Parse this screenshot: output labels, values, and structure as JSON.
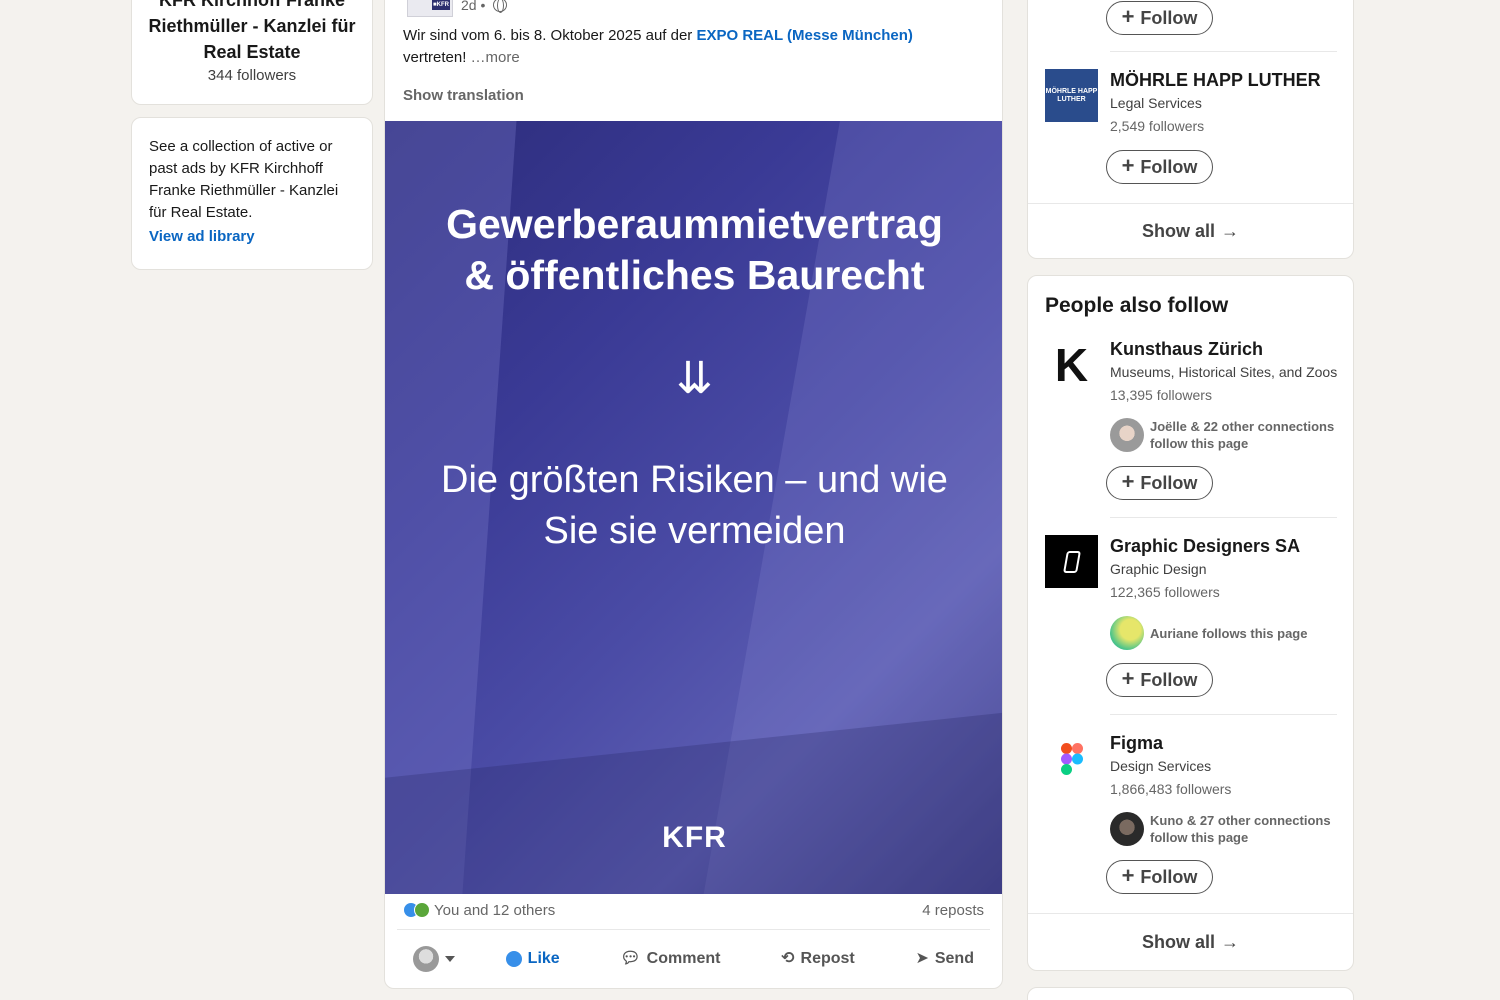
{
  "left": {
    "org_name": "KFR Kirchhoff Franke Riethmüller - Kanzlei für Real Estate",
    "followers": "344 followers",
    "ads_text": "See a collection of active or past ads by KFR Kirchhoff Franke Riethmüller - Kanzlei für Real Estate.",
    "ads_link": "View ad library"
  },
  "post": {
    "time": "2d •",
    "text_before": "Wir sind vom 6. bis 8. Oktober 2025 auf der ",
    "hashtag": "EXPO REAL (Messe München)",
    "text_after": " vertreten!",
    "more": "…more",
    "show_translation": "Show translation",
    "image": {
      "title_line1": "Gewerberaummietvertrag",
      "title_line2": "& öffentliches Baurecht",
      "arrow": "⇊",
      "sub_line1": "Die größten Risiken – und wie",
      "sub_line2": "Sie sie vermeiden",
      "brand": "KFR"
    },
    "reactions": "You and 12 others",
    "reposts": "4 reposts",
    "actions": {
      "like": "Like",
      "comment": "Comment",
      "repost": "Repost",
      "send": "Send"
    }
  },
  "right_top": {
    "follow_label": "Follow",
    "company": {
      "name": "MÖHRLE HAPP LUTHER",
      "logo_text": "MÖHRLE HAPP LUTHER",
      "industry": "Legal Services",
      "followers": "2,549 followers"
    },
    "show_all": "Show all"
  },
  "people_also_follow": {
    "title": "People also follow",
    "items": [
      {
        "name": "Kunsthaus Zürich",
        "logo_text": "K",
        "industry": "Museums, Historical Sites, and Zoos",
        "followers": "13,395 followers",
        "connections": "Joëlle & 22 other connections follow this page"
      },
      {
        "name": "Graphic Designers SA",
        "industry": "Graphic Design",
        "followers": "122,365 followers",
        "connections": "Auriane follows this page"
      },
      {
        "name": "Figma",
        "industry": "Design Services",
        "followers": "1,866,483 followers",
        "connections": "Kuno & 27 other connections follow this page"
      }
    ],
    "follow_label": "Follow",
    "show_all": "Show all"
  },
  "colors": {
    "link": "#0a66c2",
    "page_bg": "#f4f2ee",
    "post_image": "#3a3a95"
  }
}
